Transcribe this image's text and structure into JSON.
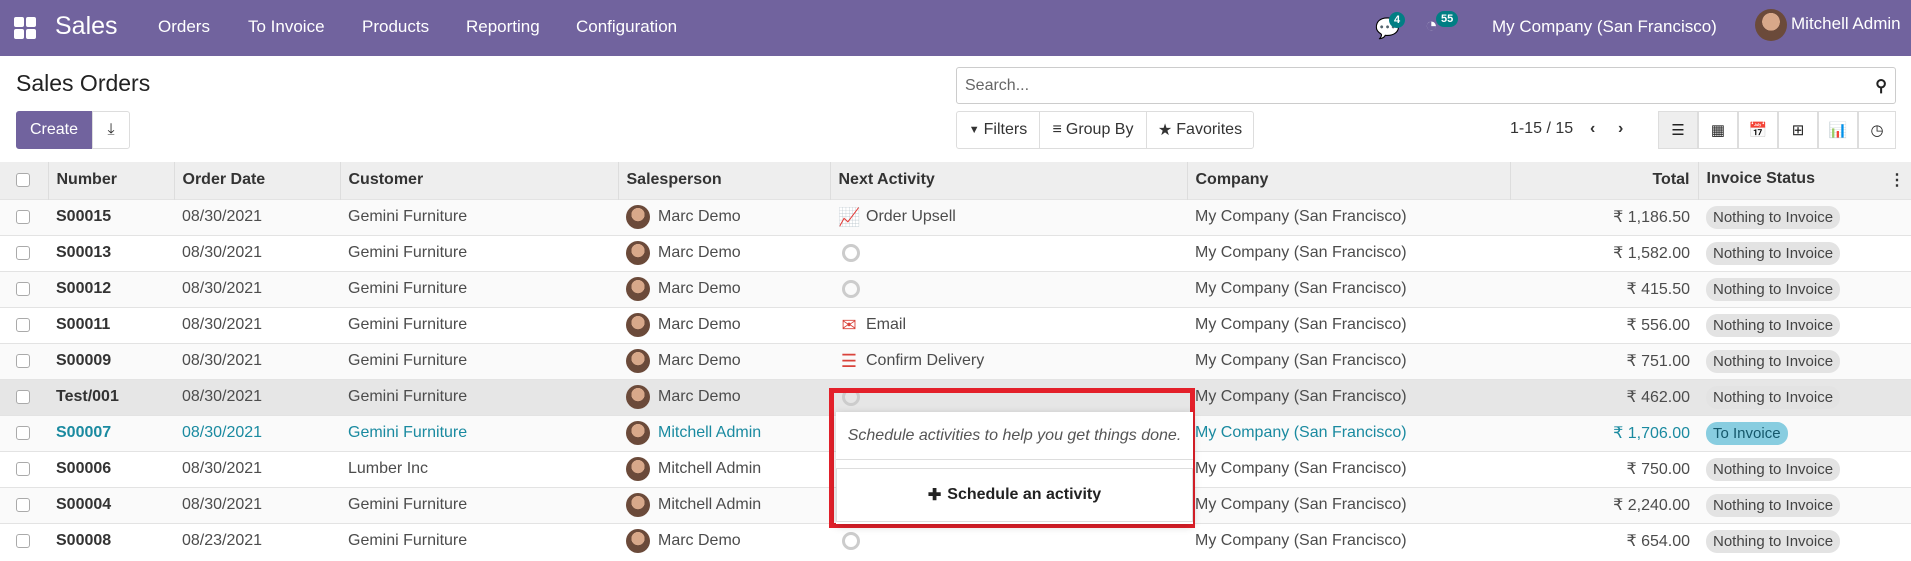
{
  "navbar": {
    "app": "Sales",
    "menu": [
      "Orders",
      "To Invoice",
      "Products",
      "Reporting",
      "Configuration"
    ],
    "messages_count": "4",
    "activities_count": "55",
    "company": "My Company (San Francisco)",
    "user": "Mitchell Admin",
    "color": "#71639e"
  },
  "page": {
    "title": "Sales Orders",
    "create_label": "Create",
    "search_placeholder": "Search...",
    "filters": "Filters",
    "group_by": "Group By",
    "favorites": "Favorites",
    "pager": "1-15 / 15"
  },
  "views": [
    "list-icon",
    "kanban-icon",
    "calendar-icon",
    "pivot-icon",
    "graph-icon",
    "activity-icon"
  ],
  "columns": [
    "Number",
    "Order Date",
    "Customer",
    "Salesperson",
    "Next Activity",
    "Company",
    "Total",
    "Invoice Status"
  ],
  "rows": [
    {
      "number": "S00015",
      "date": "08/30/2021",
      "customer": "Gemini Furniture",
      "salesperson": "Marc Demo",
      "activity": "Order Upsell",
      "activity_icon": "trend-up-icon",
      "company": "My Company (San Francisco)",
      "total": "₹ 1,186.50",
      "status": "Nothing to Invoice"
    },
    {
      "number": "S00013",
      "date": "08/30/2021",
      "customer": "Gemini Furniture",
      "salesperson": "Marc Demo",
      "activity": "",
      "activity_icon": "clock-icon",
      "company": "My Company (San Francisco)",
      "total": "₹ 1,582.00",
      "status": "Nothing to Invoice"
    },
    {
      "number": "S00012",
      "date": "08/30/2021",
      "customer": "Gemini Furniture",
      "salesperson": "Marc Demo",
      "activity": "",
      "activity_icon": "clock-icon",
      "company": "My Company (San Francisco)",
      "total": "₹ 415.50",
      "status": "Nothing to Invoice"
    },
    {
      "number": "S00011",
      "date": "08/30/2021",
      "customer": "Gemini Furniture",
      "salesperson": "Marc Demo",
      "activity": "Email",
      "activity_icon": "envelope-icon",
      "company": "My Company (San Francisco)",
      "total": "₹ 556.00",
      "status": "Nothing to Invoice"
    },
    {
      "number": "S00009",
      "date": "08/30/2021",
      "customer": "Gemini Furniture",
      "salesperson": "Marc Demo",
      "activity": "Confirm Delivery",
      "activity_icon": "tasks-icon",
      "company": "My Company (San Francisco)",
      "total": "₹ 751.00",
      "status": "Nothing to Invoice"
    },
    {
      "number": "Test/001",
      "date": "08/30/2021",
      "customer": "Gemini Furniture",
      "salesperson": "Marc Demo",
      "activity": "",
      "activity_icon": "clock-icon",
      "company": "My Company (San Francisco)",
      "total": "₹ 462.00",
      "status": "Nothing to Invoice"
    },
    {
      "number": "S00007",
      "date": "08/30/2021",
      "customer": "Gemini Furniture",
      "salesperson": "Mitchell Admin",
      "activity": "",
      "activity_icon": "",
      "company": "My Company (San Francisco)",
      "total": "₹ 1,706.00",
      "status": "To Invoice"
    },
    {
      "number": "S00006",
      "date": "08/30/2021",
      "customer": "Lumber Inc",
      "salesperson": "Mitchell Admin",
      "activity": "",
      "activity_icon": "",
      "company": "My Company (San Francisco)",
      "total": "₹ 750.00",
      "status": "Nothing to Invoice"
    },
    {
      "number": "S00004",
      "date": "08/30/2021",
      "customer": "Gemini Furniture",
      "salesperson": "Mitchell Admin",
      "activity": "",
      "activity_icon": "",
      "company": "My Company (San Francisco)",
      "total": "₹ 2,240.00",
      "status": "Nothing to Invoice"
    },
    {
      "number": "S00008",
      "date": "08/23/2021",
      "customer": "Gemini Furniture",
      "salesperson": "Marc Demo",
      "activity": "",
      "activity_icon": "clock-icon",
      "company": "My Company (San Francisco)",
      "total": "₹ 654.00",
      "status": "Nothing to Invoice"
    }
  ],
  "popover": {
    "text": "Schedule activities to help you get things done.",
    "button": "Schedule an activity"
  }
}
